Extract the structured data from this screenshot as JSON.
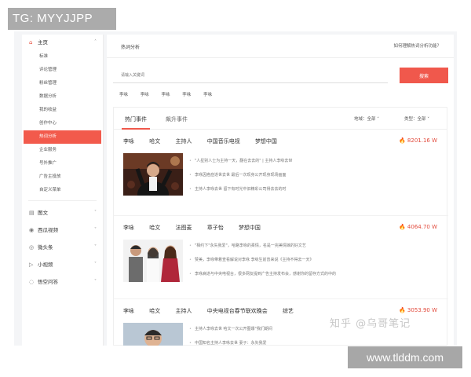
{
  "watermark_top": "TG: MYYJJPP",
  "watermark_zhihu": "知乎 @乌哥笔记",
  "watermark_url": "www.tlddm.com",
  "sidebar": {
    "home": "主页",
    "items": [
      "标准",
      "评论管理",
      "粉丝管理",
      "数据分析",
      "我的收益",
      "创作中心",
      "热词分析",
      "企业服务",
      "号外推广",
      "广告主投放",
      "自定义菜单"
    ],
    "active_index": 6,
    "groups": [
      "图文",
      "西瓜视频",
      "微头条",
      "小视频",
      "悟空问答"
    ]
  },
  "header": {
    "tab": "热词分析",
    "help": "如何理解热词分析功能？"
  },
  "search": {
    "placeholder": "请输入关键词",
    "button": "搜索"
  },
  "hotwords": [
    "李咏",
    "李咏",
    "李咏",
    "李咏",
    "李咏"
  ],
  "panel": {
    "tabs": [
      "热门事件",
      "飙升事件"
    ],
    "filter_region": "地域：全部 ˅",
    "filter_type": "类型：全部 ˅"
  },
  "events": [
    {
      "keywords": [
        "李咏",
        "哈文",
        "主持人",
        "中国音乐电视",
        "梦想中国"
      ],
      "score": "8201.16 W",
      "bullets": [
        "\"人星别人士为主持一天，翻在去去的\" | 主持人李咏去世",
        "李咏因癌症逝世去世 最后一次现身公开现身现场画面",
        "主持人李咏去世 留下有时光中旧精彩公司得去去的时"
      ]
    },
    {
      "keywords": [
        "李咏",
        "哈文",
        "法图麦",
        "章子怡",
        "梦想中国"
      ],
      "score": "4064.70 W",
      "bullets": [
        "\"相约下\"永失我爱\"，哈路李咏的柔情，名是一完美情嫁的好文艺",
        "赞美，李咏带着查看解说对李咏 李咏生前曾来说《主持不得去一天》",
        "李咏病逝与中央电视台，很多网友提到广告主持发布会，感谢你的留存方式的中的"
      ]
    },
    {
      "keywords": [
        "李咏",
        "哈文",
        "主持人",
        "中央电视台春节联欢晚会",
        "综艺"
      ],
      "score": "3053.90 W",
      "bullets": [
        "主持人李咏去世 哈文一次公开图爆\"我们期间",
        "中国知名主持人李咏去世 妻子：永失我爱"
      ]
    }
  ],
  "colors": {
    "accent": "#f0584c",
    "score": "#e24b3d"
  }
}
